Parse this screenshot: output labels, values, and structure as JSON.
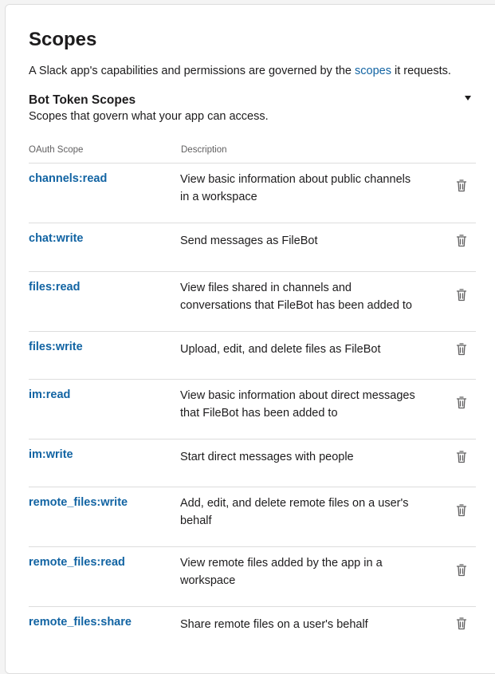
{
  "page": {
    "title": "Scopes",
    "intro_before": "A Slack app's capabilities and permissions are governed by the ",
    "intro_link": "scopes",
    "intro_after": " it requests."
  },
  "section": {
    "title": "Bot Token Scopes",
    "subtitle": "Scopes that govern what your app can access."
  },
  "table": {
    "headers": {
      "scope": "OAuth Scope",
      "description": "Description"
    },
    "rows": [
      {
        "scope": "channels:read",
        "description": "View basic information about public channels in a workspace"
      },
      {
        "scope": "chat:write",
        "description": "Send messages as FileBot"
      },
      {
        "scope": "files:read",
        "description": "View files shared in channels and conversations that FileBot has been added to"
      },
      {
        "scope": "files:write",
        "description": "Upload, edit, and delete files as FileBot"
      },
      {
        "scope": "im:read",
        "description": "View basic information about direct messages that FileBot has been added to"
      },
      {
        "scope": "im:write",
        "description": "Start direct messages with people"
      },
      {
        "scope": "remote_files:write",
        "description": "Add, edit, and delete remote files on a user's behalf"
      },
      {
        "scope": "remote_files:read",
        "description": "View remote files added by the app in a workspace"
      },
      {
        "scope": "remote_files:share",
        "description": "Share remote files on a user's behalf"
      }
    ]
  },
  "icons": {
    "row_action": "trash-icon",
    "collapse": "caret-down-icon"
  },
  "colors": {
    "link": "#1264a3",
    "border": "#dddddd"
  }
}
